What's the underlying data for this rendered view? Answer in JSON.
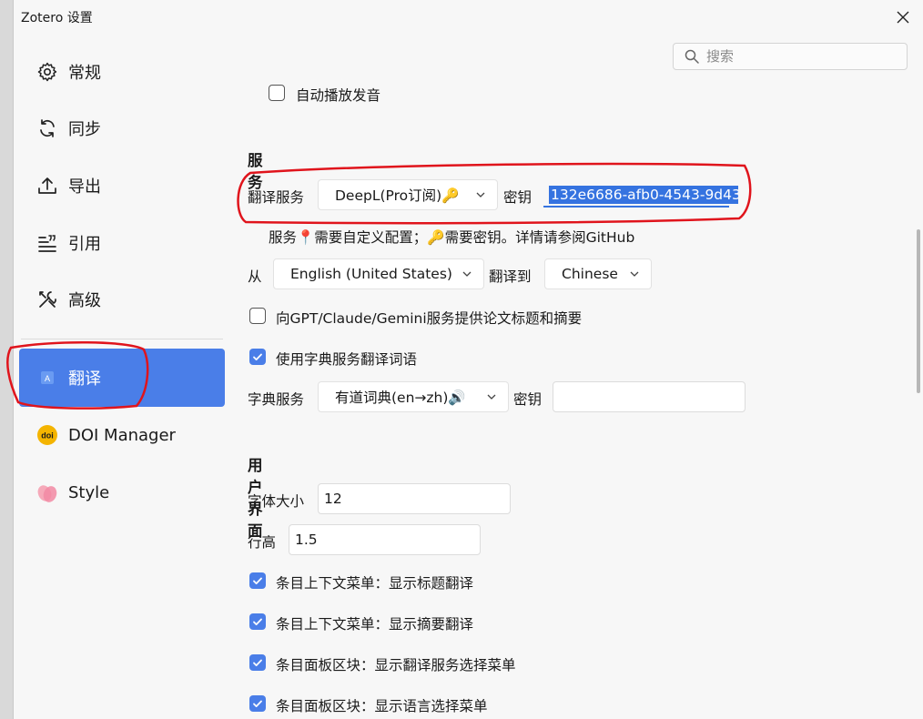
{
  "window": {
    "title": "Zotero 设置"
  },
  "search": {
    "placeholder": "搜索"
  },
  "sidebar": {
    "items": [
      {
        "label": "常规",
        "icon": "gear-icon"
      },
      {
        "label": "同步",
        "icon": "sync-icon"
      },
      {
        "label": "导出",
        "icon": "export-icon"
      },
      {
        "label": "引用",
        "icon": "cite-icon"
      },
      {
        "label": "高级",
        "icon": "tools-icon"
      },
      {
        "label": "翻译",
        "icon": "translate-icon",
        "active": true
      },
      {
        "label": "DOI Manager",
        "icon": "doi-icon"
      },
      {
        "label": "Style",
        "icon": "style-petal-icon"
      }
    ]
  },
  "main": {
    "autoplay_label": "自动播放发音",
    "autoplay_checked": false,
    "service_heading": "服务",
    "translate_service_label": "翻译服务",
    "translate_service_value": "DeepL(Pro订阅)🔑",
    "key_label": "密钥",
    "key_value": "132e6686-afb0-4543-9d43",
    "service_note": "服务📍需要自定义配置；🔑需要密钥。详情请参阅GitHub",
    "from_label": "从",
    "from_value": "English (United States)",
    "to_label": "翻译到",
    "to_value": "Chinese",
    "gpt_label": "向GPT/Claude/Gemini服务提供论文标题和摘要",
    "gpt_checked": false,
    "dict_use_label": "使用字典服务翻译词语",
    "dict_use_checked": true,
    "dict_service_label": "字典服务",
    "dict_service_value": "有道词典(en→zh)🔊",
    "dict_key_label": "密钥",
    "dict_key_value": "",
    "ui_heading": "用户界面",
    "font_size_label": "字体大小",
    "font_size_value": "12",
    "line_height_label": "行高",
    "line_height_value": "1.5",
    "check1_label": "条目上下文菜单：显示标题翻译",
    "check2_label": "条目上下文菜单：显示摘要翻译",
    "check3_label": "条目面板区块：显示翻译服务选择菜单",
    "check4_label": "条目面板区块：显示语言选择菜单"
  },
  "colors": {
    "accent": "#4a7ee8",
    "annotation": "#e0141c"
  }
}
